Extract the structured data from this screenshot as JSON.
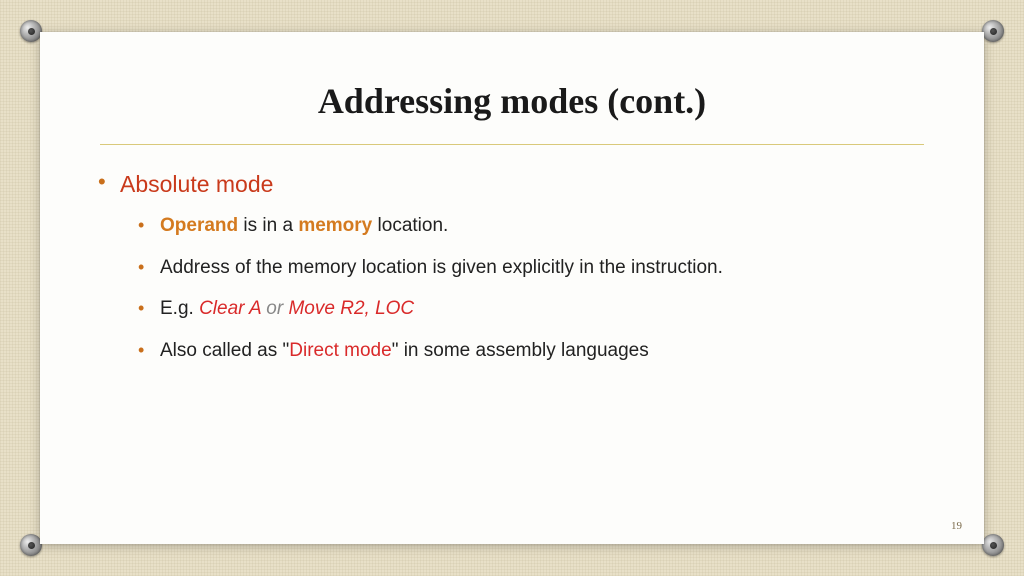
{
  "title": "Addressing modes (cont.)",
  "bullet1": "Absolute mode",
  "sub": {
    "line1": {
      "operand": "Operand",
      "mid": " is in a ",
      "memory": "memory",
      "tail": "  location."
    },
    "line2": "Address of the memory location is given explicitly in the instruction.",
    "line3": {
      "prefix": "E.g. ",
      "ex1": "Clear A",
      "or": "  or       ",
      "ex2": "Move R2, LOC"
    },
    "line4": {
      "pre": "Also called as \"",
      "direct": "Direct mode",
      "post": "\" in some assembly languages"
    }
  },
  "pageNumber": "19"
}
